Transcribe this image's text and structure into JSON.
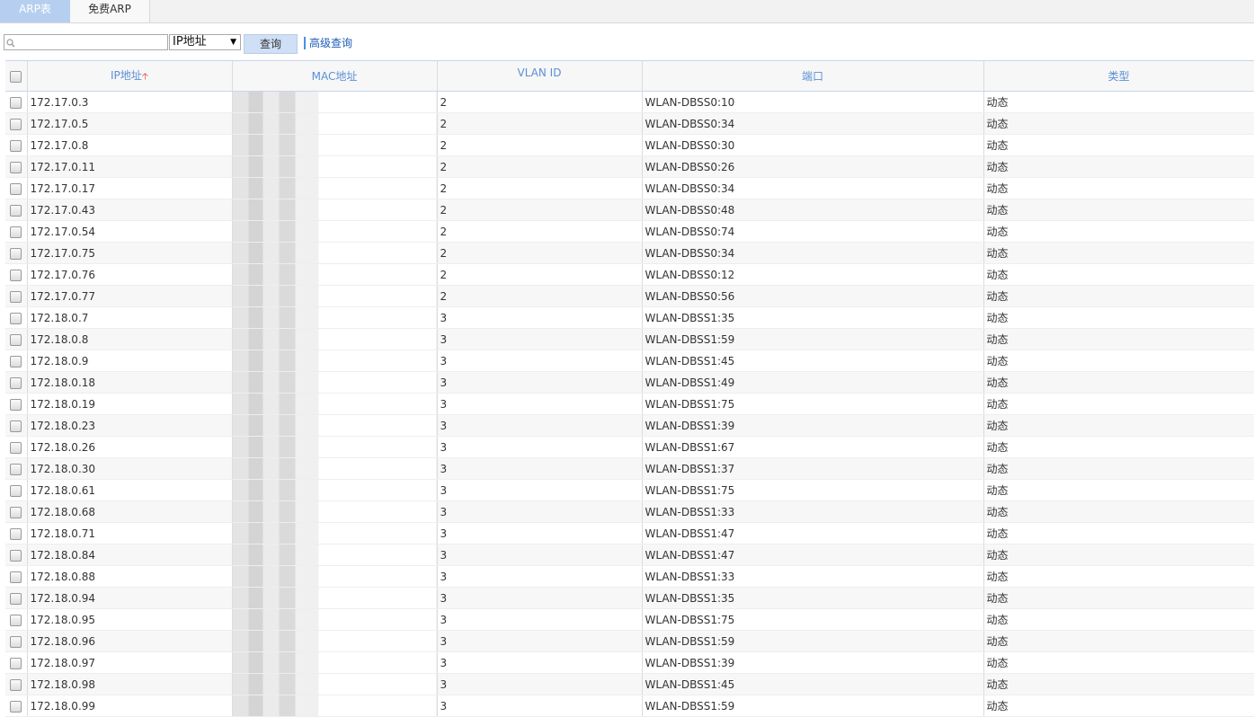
{
  "tabs": [
    {
      "label": "ARP表",
      "active": true
    },
    {
      "label": "免费ARP",
      "active": false
    }
  ],
  "toolbar": {
    "search_value": "",
    "search_placeholder": "",
    "filter_selected": "IP地址",
    "query_label": "查询",
    "advanced_label": "高级查询"
  },
  "table": {
    "columns": [
      "IP地址",
      "MAC地址",
      "VLAN ID",
      "端口",
      "类型"
    ],
    "sorted_column": "IP地址",
    "sort_direction": "ascending",
    "rows": [
      {
        "ip": "172.17.0.3",
        "mac": "",
        "vlan": "2",
        "port": "WLAN-DBSS0:10",
        "type": "动态"
      },
      {
        "ip": "172.17.0.5",
        "mac": "",
        "vlan": "2",
        "port": "WLAN-DBSS0:34",
        "type": "动态"
      },
      {
        "ip": "172.17.0.8",
        "mac": "",
        "vlan": "2",
        "port": "WLAN-DBSS0:30",
        "type": "动态"
      },
      {
        "ip": "172.17.0.11",
        "mac": "",
        "vlan": "2",
        "port": "WLAN-DBSS0:26",
        "type": "动态"
      },
      {
        "ip": "172.17.0.17",
        "mac": "",
        "vlan": "2",
        "port": "WLAN-DBSS0:34",
        "type": "动态"
      },
      {
        "ip": "172.17.0.43",
        "mac": "",
        "vlan": "2",
        "port": "WLAN-DBSS0:48",
        "type": "动态"
      },
      {
        "ip": "172.17.0.54",
        "mac": "",
        "vlan": "2",
        "port": "WLAN-DBSS0:74",
        "type": "动态"
      },
      {
        "ip": "172.17.0.75",
        "mac": "",
        "vlan": "2",
        "port": "WLAN-DBSS0:34",
        "type": "动态"
      },
      {
        "ip": "172.17.0.76",
        "mac": "",
        "vlan": "2",
        "port": "WLAN-DBSS0:12",
        "type": "动态"
      },
      {
        "ip": "172.17.0.77",
        "mac": "",
        "vlan": "2",
        "port": "WLAN-DBSS0:56",
        "type": "动态"
      },
      {
        "ip": "172.18.0.7",
        "mac": "",
        "vlan": "3",
        "port": "WLAN-DBSS1:35",
        "type": "动态"
      },
      {
        "ip": "172.18.0.8",
        "mac": "",
        "vlan": "3",
        "port": "WLAN-DBSS1:59",
        "type": "动态"
      },
      {
        "ip": "172.18.0.9",
        "mac": "",
        "vlan": "3",
        "port": "WLAN-DBSS1:45",
        "type": "动态"
      },
      {
        "ip": "172.18.0.18",
        "mac": "",
        "vlan": "3",
        "port": "WLAN-DBSS1:49",
        "type": "动态"
      },
      {
        "ip": "172.18.0.19",
        "mac": "",
        "vlan": "3",
        "port": "WLAN-DBSS1:75",
        "type": "动态"
      },
      {
        "ip": "172.18.0.23",
        "mac": "",
        "vlan": "3",
        "port": "WLAN-DBSS1:39",
        "type": "动态"
      },
      {
        "ip": "172.18.0.26",
        "mac": "",
        "vlan": "3",
        "port": "WLAN-DBSS1:67",
        "type": "动态"
      },
      {
        "ip": "172.18.0.30",
        "mac": "",
        "vlan": "3",
        "port": "WLAN-DBSS1:37",
        "type": "动态"
      },
      {
        "ip": "172.18.0.61",
        "mac": "",
        "vlan": "3",
        "port": "WLAN-DBSS1:75",
        "type": "动态"
      },
      {
        "ip": "172.18.0.68",
        "mac": "",
        "vlan": "3",
        "port": "WLAN-DBSS1:33",
        "type": "动态"
      },
      {
        "ip": "172.18.0.71",
        "mac": "",
        "vlan": "3",
        "port": "WLAN-DBSS1:47",
        "type": "动态"
      },
      {
        "ip": "172.18.0.84",
        "mac": "",
        "vlan": "3",
        "port": "WLAN-DBSS1:47",
        "type": "动态"
      },
      {
        "ip": "172.18.0.88",
        "mac": "",
        "vlan": "3",
        "port": "WLAN-DBSS1:33",
        "type": "动态"
      },
      {
        "ip": "172.18.0.94",
        "mac": "",
        "vlan": "3",
        "port": "WLAN-DBSS1:35",
        "type": "动态"
      },
      {
        "ip": "172.18.0.95",
        "mac": "",
        "vlan": "3",
        "port": "WLAN-DBSS1:75",
        "type": "动态"
      },
      {
        "ip": "172.18.0.96",
        "mac": "",
        "vlan": "3",
        "port": "WLAN-DBSS1:59",
        "type": "动态"
      },
      {
        "ip": "172.18.0.97",
        "mac": "",
        "vlan": "3",
        "port": "WLAN-DBSS1:39",
        "type": "动态"
      },
      {
        "ip": "172.18.0.98",
        "mac": "",
        "vlan": "3",
        "port": "WLAN-DBSS1:45",
        "type": "动态"
      },
      {
        "ip": "172.18.0.99",
        "mac": "",
        "vlan": "3",
        "port": "WLAN-DBSS1:59",
        "type": "动态"
      }
    ]
  },
  "icons": {
    "search": "magnifier-icon",
    "select_arrow": "triangle-down-icon",
    "sort": "arrow-up-icon"
  },
  "colors": {
    "active_tab": "#b6cff0",
    "header_text": "#5b8fd6",
    "link": "#1e5bb8",
    "sort_arrow": "#e0302a"
  }
}
